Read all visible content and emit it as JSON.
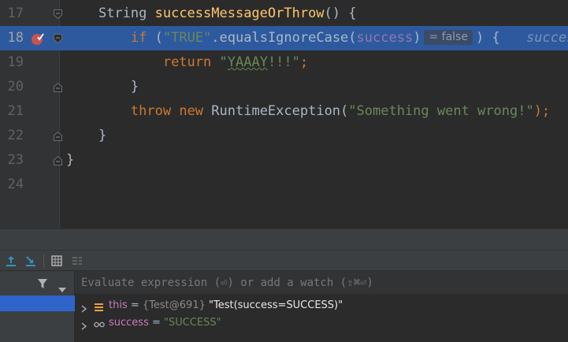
{
  "editor": {
    "lines": [
      {
        "number": "17",
        "highlight": false,
        "fold": "open",
        "code": [
          {
            "t": "    "
          },
          {
            "t": "String ",
            "c": ""
          },
          {
            "t": "successMessageOrThrow",
            "c": "fn"
          },
          {
            "t": "() {"
          }
        ]
      },
      {
        "number": "18",
        "highlight": true,
        "fold": "open",
        "breakpoint": true,
        "code": [
          {
            "t": "        "
          },
          {
            "t": "if",
            "c": "kw"
          },
          {
            "t": " ("
          },
          {
            "t": "\"TRUE\"",
            "c": "str"
          },
          {
            "t": "."
          },
          {
            "t": "equalsIgnoreCase",
            "c": ""
          },
          {
            "t": "("
          },
          {
            "t": "success",
            "c": "fld"
          },
          {
            "t": ")"
          },
          {
            "hint": "= false"
          },
          {
            "t": ") {"
          }
        ],
        "tail": "success"
      },
      {
        "number": "19",
        "highlight": false,
        "code": [
          {
            "t": "            "
          },
          {
            "t": "return",
            "c": "kw"
          },
          {
            "t": " "
          },
          {
            "t": "\"",
            "c": "str"
          },
          {
            "t": "YAAAY",
            "c": "str typo"
          },
          {
            "t": "!!!\"",
            "c": "str"
          },
          {
            "t": ";",
            "c": "kw"
          }
        ]
      },
      {
        "number": "20",
        "highlight": false,
        "fold": "close",
        "code": [
          {
            "t": "        }"
          }
        ]
      },
      {
        "number": "21",
        "highlight": false,
        "code": [
          {
            "t": "        "
          },
          {
            "t": "throw",
            "c": "kw"
          },
          {
            "t": " "
          },
          {
            "t": "new",
            "c": "kw"
          },
          {
            "t": " RuntimeException("
          },
          {
            "t": "\"Something went wrong!\"",
            "c": "str"
          },
          {
            "t": ");",
            "c": "kw"
          }
        ]
      },
      {
        "number": "22",
        "highlight": false,
        "fold": "close",
        "code": [
          {
            "t": "    }"
          }
        ]
      },
      {
        "number": "23",
        "highlight": false,
        "fold": "close",
        "code": [
          {
            "t": "}"
          }
        ]
      },
      {
        "number": "24",
        "highlight": false,
        "code": []
      }
    ]
  },
  "debug": {
    "toolbar_icons": [
      "step-up-icon",
      "step-into-icon",
      "table-icon",
      "settings-list-icon"
    ],
    "frames_icons": [
      "filter-icon",
      "dropdown-icon"
    ],
    "watch_placeholder": "Evaluate expression (⏎) or add a watch (⇧⌘⏎)",
    "variables": [
      {
        "icon": "field-icon",
        "name": "this",
        "ref": "{Test@691}",
        "value": "\"Test(success=SUCCESS)\"",
        "value_type": "plain"
      },
      {
        "icon": "watch-glasses-icon",
        "name": "success",
        "ref": "",
        "value": "\"SUCCESS\"",
        "value_type": "string"
      }
    ]
  },
  "colors": {
    "editor_bg": "#2b2b2b",
    "highlight": "#2d5a9e",
    "keyword": "#cc7832",
    "function": "#ffc66d",
    "string": "#6a8759",
    "field": "#9876aa",
    "selected_frame": "#2f65ca"
  }
}
